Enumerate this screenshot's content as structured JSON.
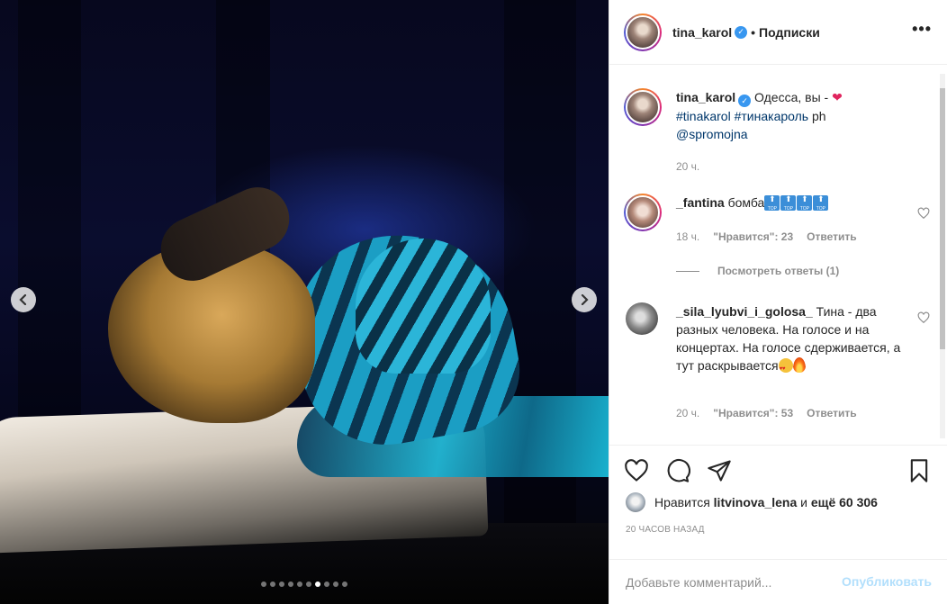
{
  "post": {
    "media": {
      "slides_total": 10,
      "active_slide": 7,
      "prev_icon": "chevron-left-icon",
      "next_icon": "chevron-right-icon"
    },
    "header": {
      "username": "tina_karol",
      "separator": "•",
      "follow_status": "Подписки",
      "more_icon": "•••"
    },
    "caption": {
      "username": "tina_karol",
      "text": "Одесса, вы -",
      "emoji": "❤",
      "hashtag1": "#tinakarol",
      "hashtag2": "#тинакароль",
      "suffix": "ph",
      "mention": "@spromojna",
      "time": "20 ч."
    },
    "comments": [
      {
        "username": "_fantina",
        "text": "бомба",
        "emoji_label": "TOP",
        "time": "18 ч.",
        "likes": "\"Нравится\": 23",
        "reply": "Ответить",
        "view_replies": "Посмотреть ответы (1)"
      },
      {
        "username": "_sila_lyubvi_i_golosa_",
        "text": "Тина - два разных человека. На голосе и на концертах. На голосе сдерживается, а тут раскрывается",
        "time": "20 ч.",
        "likes": "\"Нравится\": 53",
        "reply": "Ответить"
      }
    ],
    "likes_summary": {
      "prefix": "Нравится",
      "user": "litvinova_lena",
      "and_more": "и",
      "count_text": "ещё 60 306"
    },
    "timestamp": "20 ЧАСОВ НАЗАД",
    "comment_box": {
      "placeholder": "Добавьте комментарий...",
      "publish": "Опубликовать"
    },
    "colors": {
      "link": "#00376b",
      "muted": "#8e8e8e",
      "verified": "#3897f0",
      "publish_disabled": "#b2dffc"
    }
  }
}
